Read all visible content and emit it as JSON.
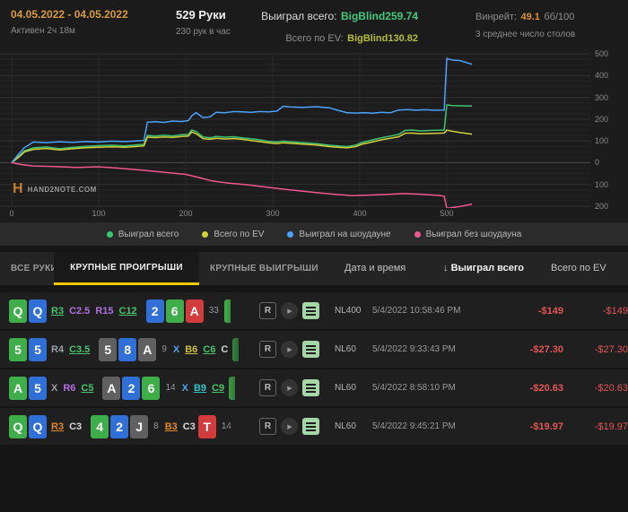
{
  "header": {
    "date_range": "04.05.2022 - 04.05.2022",
    "active_time": "Активен 2ч 18м",
    "hands": "529 Руки",
    "hands_per_hour": "230 рук в час",
    "won_label": "Выиграл всего:",
    "won_value": "BigBlind259.74",
    "ev_label": "Всего по EV:",
    "ev_value": "BigBlind130.82",
    "winrate_label": "Винрейт:",
    "winrate_value": "49.1",
    "winrate_unit": "бб/100",
    "avg_tables": "3 среднее число столов"
  },
  "logo": {
    "mark": "H",
    "text": "HAND2NOTE.COM"
  },
  "chart_data": {
    "type": "line",
    "xlabel": "",
    "ylabel": "",
    "xlim": [
      0,
      529
    ],
    "ylim": [
      -200,
      500
    ],
    "x_ticks": [
      0,
      100,
      200,
      300,
      400,
      500
    ],
    "y_ticks": [
      500,
      400,
      300,
      200,
      100,
      0,
      -100,
      -200
    ],
    "grid": true,
    "legend_position": "bottom",
    "series": [
      {
        "name": "Выиграл всего",
        "color": "#3fc472",
        "points": [
          [
            0,
            0
          ],
          [
            8,
            30
          ],
          [
            15,
            55
          ],
          [
            25,
            68
          ],
          [
            40,
            72
          ],
          [
            55,
            64
          ],
          [
            70,
            70
          ],
          [
            85,
            75
          ],
          [
            100,
            78
          ],
          [
            115,
            80
          ],
          [
            130,
            77
          ],
          [
            145,
            82
          ],
          [
            152,
            84
          ],
          [
            156,
            125
          ],
          [
            165,
            122
          ],
          [
            175,
            126
          ],
          [
            185,
            123
          ],
          [
            195,
            128
          ],
          [
            203,
            130
          ],
          [
            207,
            150
          ],
          [
            212,
            143
          ],
          [
            220,
            118
          ],
          [
            228,
            114
          ],
          [
            235,
            120
          ],
          [
            245,
            117
          ],
          [
            255,
            119
          ],
          [
            265,
            114
          ],
          [
            275,
            110
          ],
          [
            285,
            105
          ],
          [
            295,
            98
          ],
          [
            305,
            95
          ],
          [
            312,
            99
          ],
          [
            320,
            96
          ],
          [
            335,
            92
          ],
          [
            350,
            88
          ],
          [
            365,
            80
          ],
          [
            375,
            77
          ],
          [
            385,
            74
          ],
          [
            395,
            80
          ],
          [
            402,
            92
          ],
          [
            415,
            105
          ],
          [
            425,
            114
          ],
          [
            435,
            122
          ],
          [
            445,
            130
          ],
          [
            452,
            148
          ],
          [
            460,
            150
          ],
          [
            470,
            146
          ],
          [
            480,
            148
          ],
          [
            490,
            149
          ],
          [
            497,
            150
          ],
          [
            500,
            265
          ],
          [
            507,
            262
          ],
          [
            515,
            261
          ],
          [
            529,
            260
          ]
        ]
      },
      {
        "name": "Всего по EV",
        "color": "#d2cf3a",
        "points": [
          [
            0,
            0
          ],
          [
            8,
            25
          ],
          [
            15,
            50
          ],
          [
            25,
            61
          ],
          [
            40,
            65
          ],
          [
            55,
            58
          ],
          [
            70,
            64
          ],
          [
            85,
            69
          ],
          [
            100,
            71
          ],
          [
            115,
            73
          ],
          [
            130,
            71
          ],
          [
            145,
            75
          ],
          [
            152,
            77
          ],
          [
            156,
            117
          ],
          [
            165,
            115
          ],
          [
            175,
            118
          ],
          [
            185,
            116
          ],
          [
            195,
            120
          ],
          [
            203,
            122
          ],
          [
            207,
            141
          ],
          [
            212,
            133
          ],
          [
            220,
            110
          ],
          [
            228,
            107
          ],
          [
            235,
            112
          ],
          [
            245,
            109
          ],
          [
            255,
            111
          ],
          [
            265,
            107
          ],
          [
            275,
            102
          ],
          [
            285,
            97
          ],
          [
            295,
            91
          ],
          [
            305,
            88
          ],
          [
            312,
            91
          ],
          [
            320,
            89
          ],
          [
            335,
            85
          ],
          [
            350,
            81
          ],
          [
            365,
            74
          ],
          [
            375,
            71
          ],
          [
            385,
            68
          ],
          [
            395,
            73
          ],
          [
            402,
            84
          ],
          [
            415,
            96
          ],
          [
            425,
            105
          ],
          [
            435,
            112
          ],
          [
            445,
            119
          ],
          [
            452,
            135
          ],
          [
            460,
            136
          ],
          [
            470,
            133
          ],
          [
            480,
            134
          ],
          [
            490,
            135
          ],
          [
            497,
            136
          ],
          [
            500,
            149
          ],
          [
            507,
            144
          ],
          [
            515,
            139
          ],
          [
            529,
            131
          ]
        ]
      },
      {
        "name": "Выиграл на шоудауне",
        "color": "#4aa3ff",
        "points": [
          [
            0,
            0
          ],
          [
            8,
            40
          ],
          [
            15,
            70
          ],
          [
            25,
            95
          ],
          [
            40,
            92
          ],
          [
            55,
            96
          ],
          [
            70,
            93
          ],
          [
            85,
            97
          ],
          [
            100,
            95
          ],
          [
            115,
            99
          ],
          [
            130,
            97
          ],
          [
            145,
            100
          ],
          [
            152,
            102
          ],
          [
            156,
            186
          ],
          [
            165,
            188
          ],
          [
            175,
            185
          ],
          [
            185,
            191
          ],
          [
            195,
            189
          ],
          [
            203,
            193
          ],
          [
            207,
            215
          ],
          [
            212,
            230
          ],
          [
            220,
            207
          ],
          [
            228,
            211
          ],
          [
            235,
            231
          ],
          [
            245,
            229
          ],
          [
            255,
            235
          ],
          [
            265,
            233
          ],
          [
            275,
            231
          ],
          [
            285,
            235
          ],
          [
            295,
            233
          ],
          [
            305,
            237
          ],
          [
            312,
            259
          ],
          [
            320,
            256
          ],
          [
            335,
            254
          ],
          [
            350,
            257
          ],
          [
            365,
            252
          ],
          [
            375,
            240
          ],
          [
            385,
            230
          ],
          [
            395,
            228
          ],
          [
            405,
            230
          ],
          [
            415,
            227
          ],
          [
            425,
            231
          ],
          [
            435,
            229
          ],
          [
            445,
            242
          ],
          [
            455,
            244
          ],
          [
            465,
            241
          ],
          [
            475,
            243
          ],
          [
            485,
            241
          ],
          [
            497,
            242
          ],
          [
            500,
            478
          ],
          [
            507,
            471
          ],
          [
            515,
            469
          ],
          [
            529,
            452
          ]
        ]
      },
      {
        "name": "Выиграл без шоудауна",
        "color": "#f0568e",
        "points": [
          [
            0,
            0
          ],
          [
            10,
            -8
          ],
          [
            25,
            -15
          ],
          [
            50,
            -18
          ],
          [
            75,
            -22
          ],
          [
            100,
            -19
          ],
          [
            125,
            -26
          ],
          [
            150,
            -34
          ],
          [
            175,
            -44
          ],
          [
            200,
            -54
          ],
          [
            215,
            -68
          ],
          [
            230,
            -84
          ],
          [
            250,
            -94
          ],
          [
            270,
            -101
          ],
          [
            290,
            -111
          ],
          [
            310,
            -121
          ],
          [
            330,
            -129
          ],
          [
            350,
            -137
          ],
          [
            370,
            -145
          ],
          [
            390,
            -151
          ],
          [
            410,
            -149
          ],
          [
            430,
            -146
          ],
          [
            450,
            -142
          ],
          [
            470,
            -145
          ],
          [
            490,
            -150
          ],
          [
            497,
            -154
          ],
          [
            500,
            -210
          ],
          [
            507,
            -206
          ],
          [
            517,
            -200
          ],
          [
            529,
            -190
          ]
        ]
      }
    ]
  },
  "tabs": [
    {
      "label": "ВСЕ РУКИ",
      "active": false
    },
    {
      "label": "КРУПНЫЕ ПРОИГРЫШИ",
      "active": true
    },
    {
      "label": "КРУПНЫЕ ВЫИГРЫШИ",
      "active": false
    }
  ],
  "columns": {
    "date": "Дата и время",
    "won_sort": "↓",
    "won": "Выиграл всего",
    "ev": "Всего по EV"
  },
  "table": {
    "buttons": {
      "replayer_label": "R"
    },
    "rows": [
      {
        "tokens": [
          {
            "t": "card",
            "v": "Q",
            "s": "c"
          },
          {
            "t": "card",
            "v": "Q",
            "s": "d"
          },
          {
            "t": "act",
            "v": "R3",
            "c": "green",
            "u": 1
          },
          {
            "t": "act",
            "v": "C2.5",
            "c": "violet"
          },
          {
            "t": "act",
            "v": "R15",
            "c": "violet"
          },
          {
            "t": "act",
            "v": "C12",
            "c": "green",
            "u": 1
          },
          {
            "t": "gap"
          },
          {
            "t": "card",
            "v": "2",
            "s": "d"
          },
          {
            "t": "card",
            "v": "6",
            "s": "c"
          },
          {
            "t": "card",
            "v": "A",
            "s": "h"
          },
          {
            "t": "pot",
            "v": "33"
          },
          {
            "t": "cut",
            "s": "c"
          }
        ],
        "stake": "NL400",
        "date": "5/4/2022 10:58:46 PM",
        "won": "-$149",
        "ev": "-$149"
      },
      {
        "tokens": [
          {
            "t": "card",
            "v": "5",
            "s": "c"
          },
          {
            "t": "card",
            "v": "5",
            "s": "d"
          },
          {
            "t": "act",
            "v": "R4",
            "c": "gray"
          },
          {
            "t": "act",
            "v": "C3.5",
            "c": "green",
            "u": 1
          },
          {
            "t": "gap"
          },
          {
            "t": "card",
            "v": "5",
            "s": "s"
          },
          {
            "t": "card",
            "v": "8",
            "s": "d"
          },
          {
            "t": "card",
            "v": "A",
            "s": "s"
          },
          {
            "t": "pot",
            "v": "9"
          },
          {
            "t": "act",
            "v": "X",
            "c": "blue"
          },
          {
            "t": "act",
            "v": "B6",
            "c": "yellow",
            "u": 1
          },
          {
            "t": "act",
            "v": "C6",
            "c": "green",
            "u": 1
          },
          {
            "t": "act",
            "v": "C",
            "c": "white"
          },
          {
            "t": "cut",
            "s": "c"
          }
        ],
        "stake": "NL60",
        "date": "5/4/2022 9:33:43 PM",
        "won": "-$27.30",
        "ev": "-$27.30"
      },
      {
        "tokens": [
          {
            "t": "card",
            "v": "A",
            "s": "c"
          },
          {
            "t": "card",
            "v": "5",
            "s": "d"
          },
          {
            "t": "act",
            "v": "X",
            "c": "gray"
          },
          {
            "t": "act",
            "v": "R6",
            "c": "violet"
          },
          {
            "t": "act",
            "v": "C5",
            "c": "green",
            "u": 1
          },
          {
            "t": "gap"
          },
          {
            "t": "card",
            "v": "A",
            "s": "s"
          },
          {
            "t": "card",
            "v": "2",
            "s": "d"
          },
          {
            "t": "card",
            "v": "6",
            "s": "c"
          },
          {
            "t": "pot",
            "v": "14"
          },
          {
            "t": "act",
            "v": "X",
            "c": "blue"
          },
          {
            "t": "act",
            "v": "B9",
            "c": "teal",
            "u": 1
          },
          {
            "t": "act",
            "v": "C9",
            "c": "green",
            "u": 1
          },
          {
            "t": "cut",
            "s": "c"
          }
        ],
        "stake": "NL60",
        "date": "5/4/2022 8:58:10 PM",
        "won": "-$20.63",
        "ev": "-$20.63"
      },
      {
        "tokens": [
          {
            "t": "card",
            "v": "Q",
            "s": "c"
          },
          {
            "t": "card",
            "v": "Q",
            "s": "d"
          },
          {
            "t": "act",
            "v": "R3",
            "c": "orange",
            "u": 1
          },
          {
            "t": "act",
            "v": "C3",
            "c": "white"
          },
          {
            "t": "gap"
          },
          {
            "t": "card",
            "v": "4",
            "s": "c"
          },
          {
            "t": "card",
            "v": "2",
            "s": "d"
          },
          {
            "t": "card",
            "v": "J",
            "s": "s"
          },
          {
            "t": "pot",
            "v": "8"
          },
          {
            "t": "act",
            "v": "B3",
            "c": "orange",
            "u": 1
          },
          {
            "t": "act",
            "v": "C3",
            "c": "white"
          },
          {
            "t": "card",
            "v": "T",
            "s": "h"
          },
          {
            "t": "pot",
            "v": "14"
          }
        ],
        "stake": "NL60",
        "date": "5/4/2022 9:45:21 PM",
        "won": "-$19.97",
        "ev": "-$19.97"
      }
    ]
  }
}
